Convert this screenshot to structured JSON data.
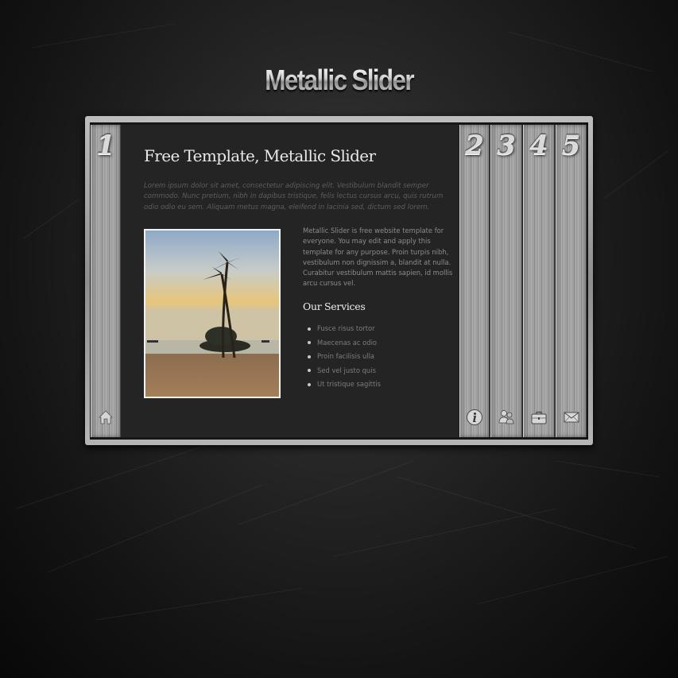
{
  "logo": {
    "text": "Metallic Slider"
  },
  "panels": [
    {
      "number": "1",
      "icon": "home-icon"
    },
    {
      "number": "2",
      "icon": "info-icon"
    },
    {
      "number": "3",
      "icon": "users-icon"
    },
    {
      "number": "4",
      "icon": "briefcase-icon"
    },
    {
      "number": "5",
      "icon": "mail-icon"
    }
  ],
  "content": {
    "title": "Free Template, Metallic Slider",
    "intro": "Lorem ipsum dolor sit amet, consectetur adipiscing elit. Vestibulum blandit semper commodo. Nunc pretium, nibh in dapibus tristique, felis lectus cursus arcu, quis rutrum odio odio eu sem. Aliquam metus magna, eleifend in lacinia sed, dictum sed lorem.",
    "body": "Metallic Slider is free website template for everyone. You may edit and apply this template for any purpose. Proin turpis nibh, vestibulum non dignissim a, blandit at nulla. Curabitur vestibulum mattis sapien, id mollis arcu cursus vel.",
    "services_title": "Our Services",
    "services": [
      "Fusce risus tortor",
      "Maecenas ac odio",
      "Proin facilisis ulla",
      "Sed vel justo quis",
      "Ut tristique sagittis"
    ]
  },
  "colors": {
    "background": "#1a1a1a",
    "panel_metal": "#a8a8a8",
    "content_bg": "#242424",
    "title_text": "#e9e9e9"
  }
}
